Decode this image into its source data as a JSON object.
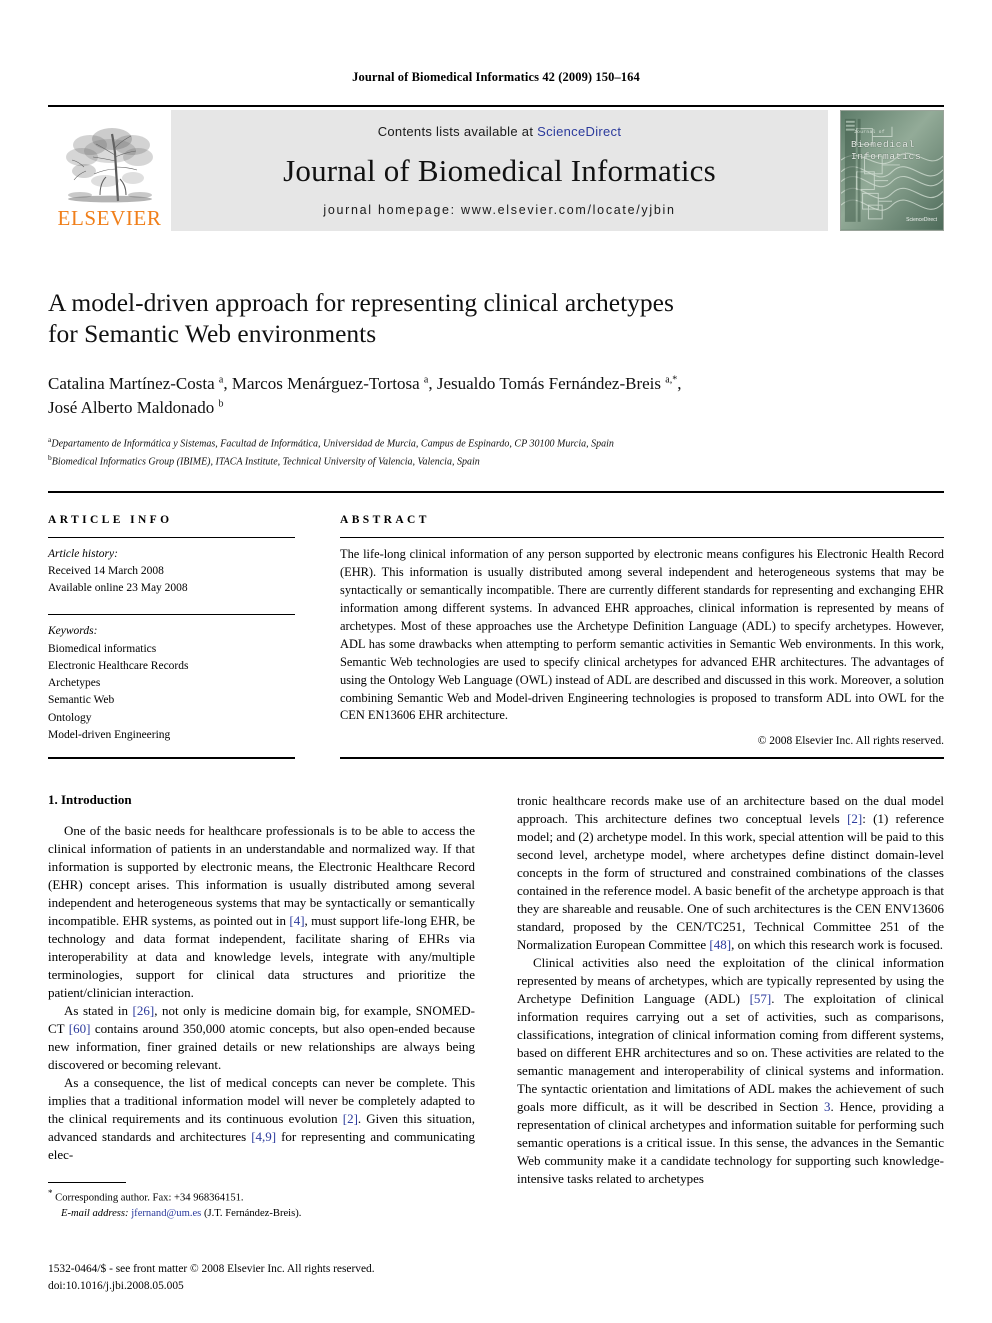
{
  "running_head": "Journal of Biomedical Informatics 42 (2009) 150–164",
  "masthead": {
    "publisher_name": "ELSEVIER",
    "contents_prefix": "Contents lists available at ",
    "contents_link": "ScienceDirect",
    "journal_title": "Journal of Biomedical Informatics",
    "homepage": "journal homepage: www.elsevier.com/locate/yjbin",
    "cover": {
      "mini_label": "Journal of",
      "title_line1": "Biomedical",
      "title_line2": "Informatics",
      "badge": "ScienceDirect"
    }
  },
  "article": {
    "title_line1": "A model-driven approach for representing clinical archetypes",
    "title_line2": "for Semantic Web environments",
    "authors_line1": "Catalina Martínez-Costa ",
    "authors_sup_a1": "a",
    "authors_line1b": ", Marcos Menárguez-Tortosa ",
    "authors_sup_a2": "a",
    "authors_line1c": ", Jesualdo Tomás Fernández-Breis ",
    "authors_sup_a3": "a,*",
    "authors_line1d": ",",
    "authors_line2": "José Alberto Maldonado ",
    "authors_sup_b": "b",
    "affiliation_a_sup": "a",
    "affiliation_a": "Departamento de Informática y Sistemas, Facultad de Informática, Universidad de Murcia, Campus de Espinardo, CP 30100 Murcia, Spain",
    "affiliation_b_sup": "b",
    "affiliation_b": "Biomedical Informatics Group (IBIME), ITACA Institute, Technical University of Valencia, Valencia, Spain"
  },
  "article_info": {
    "label": "ARTICLE INFO",
    "history_label": "Article history:",
    "history": [
      "Received 14 March 2008",
      "Available online 23 May 2008"
    ],
    "keywords_label": "Keywords:",
    "keywords": [
      "Biomedical informatics",
      "Electronic Healthcare Records",
      "Archetypes",
      "Semantic Web",
      "Ontology",
      "Model-driven Engineering"
    ]
  },
  "abstract": {
    "label": "ABSTRACT",
    "text": "The life-long clinical information of any person supported by electronic means configures his Electronic Health Record (EHR). This information is usually distributed among several independent and heterogeneous systems that may be syntactically or semantically incompatible. There are currently different standards for representing and exchanging EHR information among different systems. In advanced EHR approaches, clinical information is represented by means of archetypes. Most of these approaches use the Archetype Definition Language (ADL) to specify archetypes. However, ADL has some drawbacks when attempting to perform semantic activities in Semantic Web environments. In this work, Semantic Web technologies are used to specify clinical archetypes for advanced EHR architectures. The advantages of using the Ontology Web Language (OWL) instead of ADL are described and discussed in this work. Moreover, a solution combining Semantic Web and Model-driven Engineering technologies is proposed to transform ADL into OWL for the CEN EN13606 EHR architecture.",
    "copyright": "© 2008 Elsevier Inc. All rights reserved."
  },
  "body": {
    "section_title": "1. Introduction",
    "left_paragraphs": [
      "One of the basic needs for healthcare professionals is to be able to access the clinical information of patients in an understandable and normalized way. If that information is supported by electronic means, the Electronic Healthcare Record (EHR) concept arises. This information is usually distributed among several independent and heterogeneous systems that may be syntactically or semantically incompatible. EHR systems, as pointed out in [4], must support life-long EHR, be technology and data format independent, facilitate sharing of EHRs via interoperability at data and knowledge levels, integrate with any/multiple terminologies, support for clinical data structures and prioritize the patient/clinician interaction.",
      "As stated in [26], not only is medicine domain big, for example, SNOMED-CT [60] contains around 350,000 atomic concepts, but also open-ended because new information, finer grained details or new relationships are always being discovered or becoming relevant.",
      "As a consequence, the list of medical concepts can never be complete. This implies that a traditional information model will never be completely adapted to the clinical requirements and its continuous evolution [2]. Given this situation, advanced standards and architectures [4,9] for representing and communicating elec-"
    ],
    "right_paragraphs": [
      "tronic healthcare records make use of an architecture based on the dual model approach. This architecture defines two conceptual levels [2]: (1) reference model; and (2) archetype model. In this work, special attention will be paid to this second level, archetype model, where archetypes define distinct domain-level concepts in the form of structured and constrained combinations of the classes contained in the reference model. A basic benefit of the archetype approach is that they are shareable and reusable. One of such architectures is the CEN ENV13606 standard, proposed by the CEN/TC251, Technical Committee 251 of the Normalization European Committee [48], on which this research work is focused.",
      "Clinical activities also need the exploitation of the clinical information represented by means of archetypes, which are typically represented by using the Archetype Definition Language (ADL) [57]. The exploitation of clinical information requires carrying out a set of activities, such as comparisons, classifications, integration of clinical information coming from different systems, based on different EHR architectures and so on. These activities are related to the semantic management and interoperability of clinical systems and information. The syntactic orientation and limitations of ADL makes the achievement of such goals more difficult, as it will be described in Section 3. Hence, providing a representation of clinical archetypes and information suitable for performing such semantic operations is a critical issue. In this sense, the advances in the Semantic Web community make it a candidate technology for supporting such knowledge-intensive tasks related to archetypes"
    ]
  },
  "footnotes": {
    "corresponding": "Corresponding author. Fax: +34 968364151.",
    "email_label": "E-mail address:",
    "email": "jfernand@um.es",
    "email_suffix": "(J.T. Fernández-Breis)."
  },
  "footer": {
    "issn_line": "1532-0464/$ - see front matter © 2008 Elsevier Inc. All rights reserved.",
    "doi_line": "doi:10.1016/j.jbi.2008.05.005"
  },
  "colors": {
    "link": "#2b3a9c",
    "elsevier_orange": "#F07F1A",
    "masthead_bg": "#e6e6e6"
  }
}
